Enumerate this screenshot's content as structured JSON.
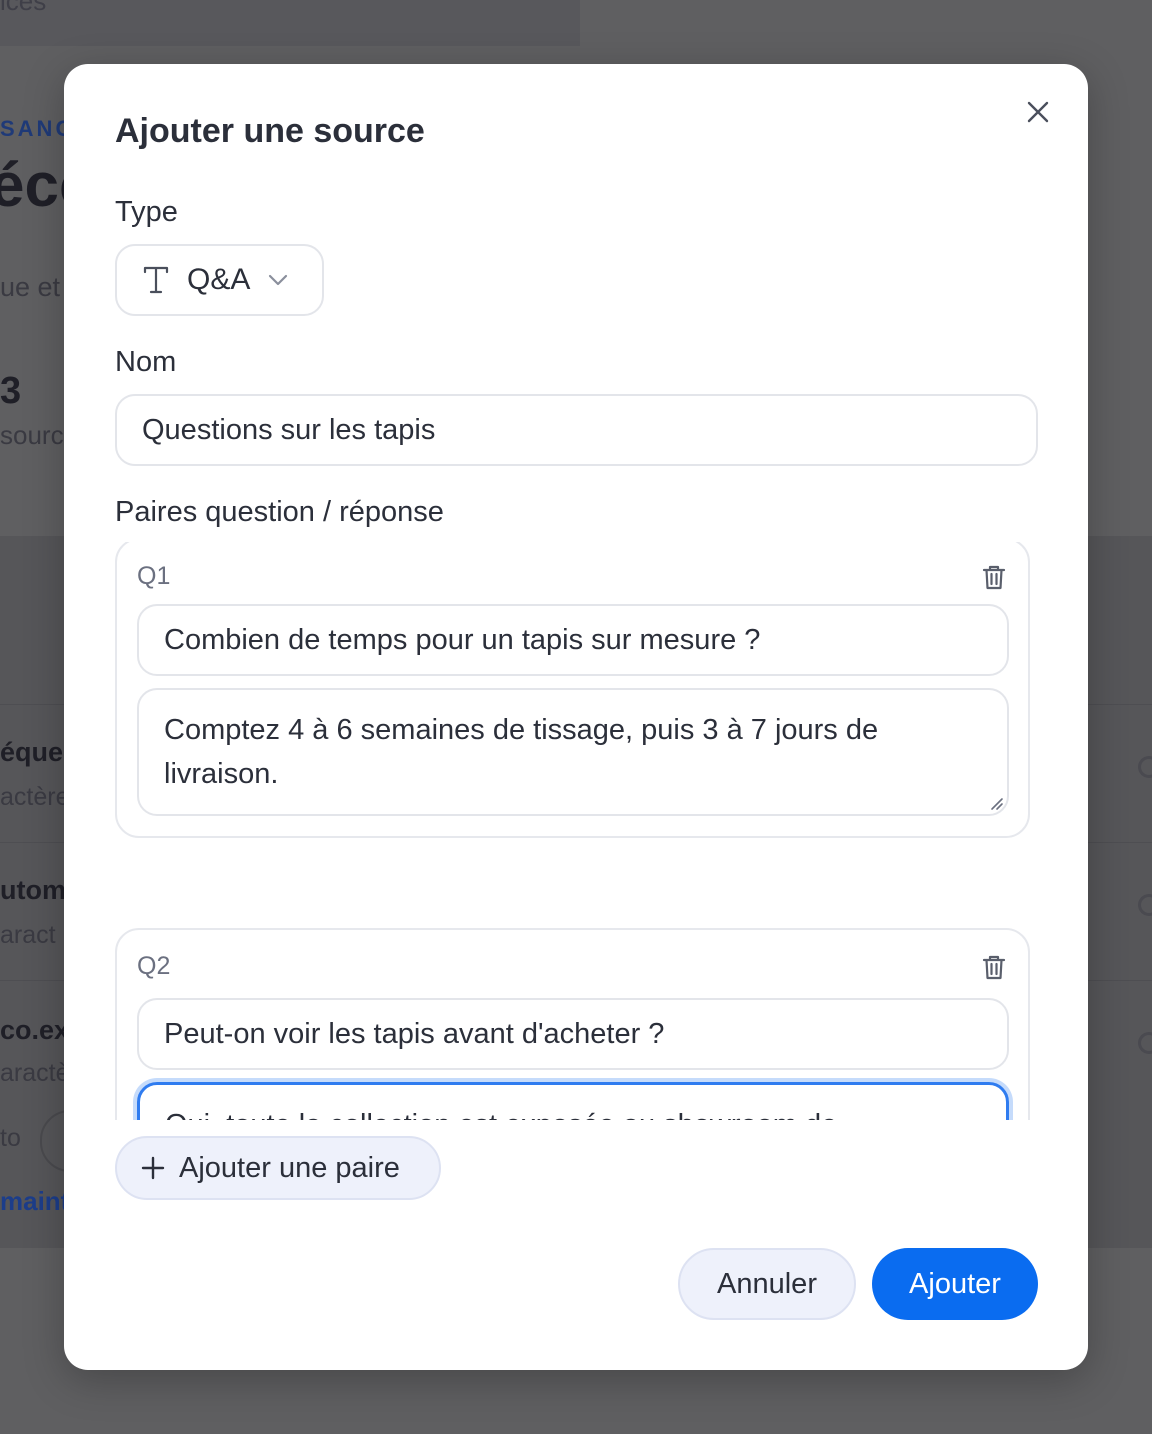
{
  "background": {
    "top_fragment": "ices",
    "eyebrow": "SANC",
    "big_title": "écc",
    "subtitle": "ue et",
    "count": "3",
    "count_label": "sourc",
    "rows": [
      {
        "title": "équel",
        "subtitle": "actère"
      },
      {
        "title": "utom",
        "subtitle": "aract"
      },
      {
        "title": "co.ex",
        "subtitle": "aractè"
      }
    ],
    "to_text": "to",
    "link_text": "maint"
  },
  "modal": {
    "title": "Ajouter une source",
    "close_icon": "close-icon",
    "type": {
      "label": "Type",
      "value": "Q&A",
      "icon": "text-type-icon"
    },
    "name": {
      "label": "Nom",
      "value": "Questions sur les tapis"
    },
    "pairs": {
      "label": "Paires question / réponse",
      "items": [
        {
          "label": "Q1",
          "question": "Combien de temps pour un tapis sur mesure ?",
          "answer": "Comptez 4 à 6 semaines de tissage, puis 3 à 7 jours de livraison."
        },
        {
          "label": "Q2",
          "question": "Peut-on voir les tapis avant d'acheter ?",
          "answer": "Oui, toute la collection est exposée au showroom de Casablanca."
        }
      ]
    },
    "add_pair_label": "Ajouter une paire",
    "cancel_label": "Annuler",
    "submit_label": "Ajouter"
  },
  "colors": {
    "primary": "#0a6cf0",
    "overlay": "#5f5f61",
    "focus_ring": "#2f7cf0",
    "secondary_button_bg": "#eef1fb"
  }
}
